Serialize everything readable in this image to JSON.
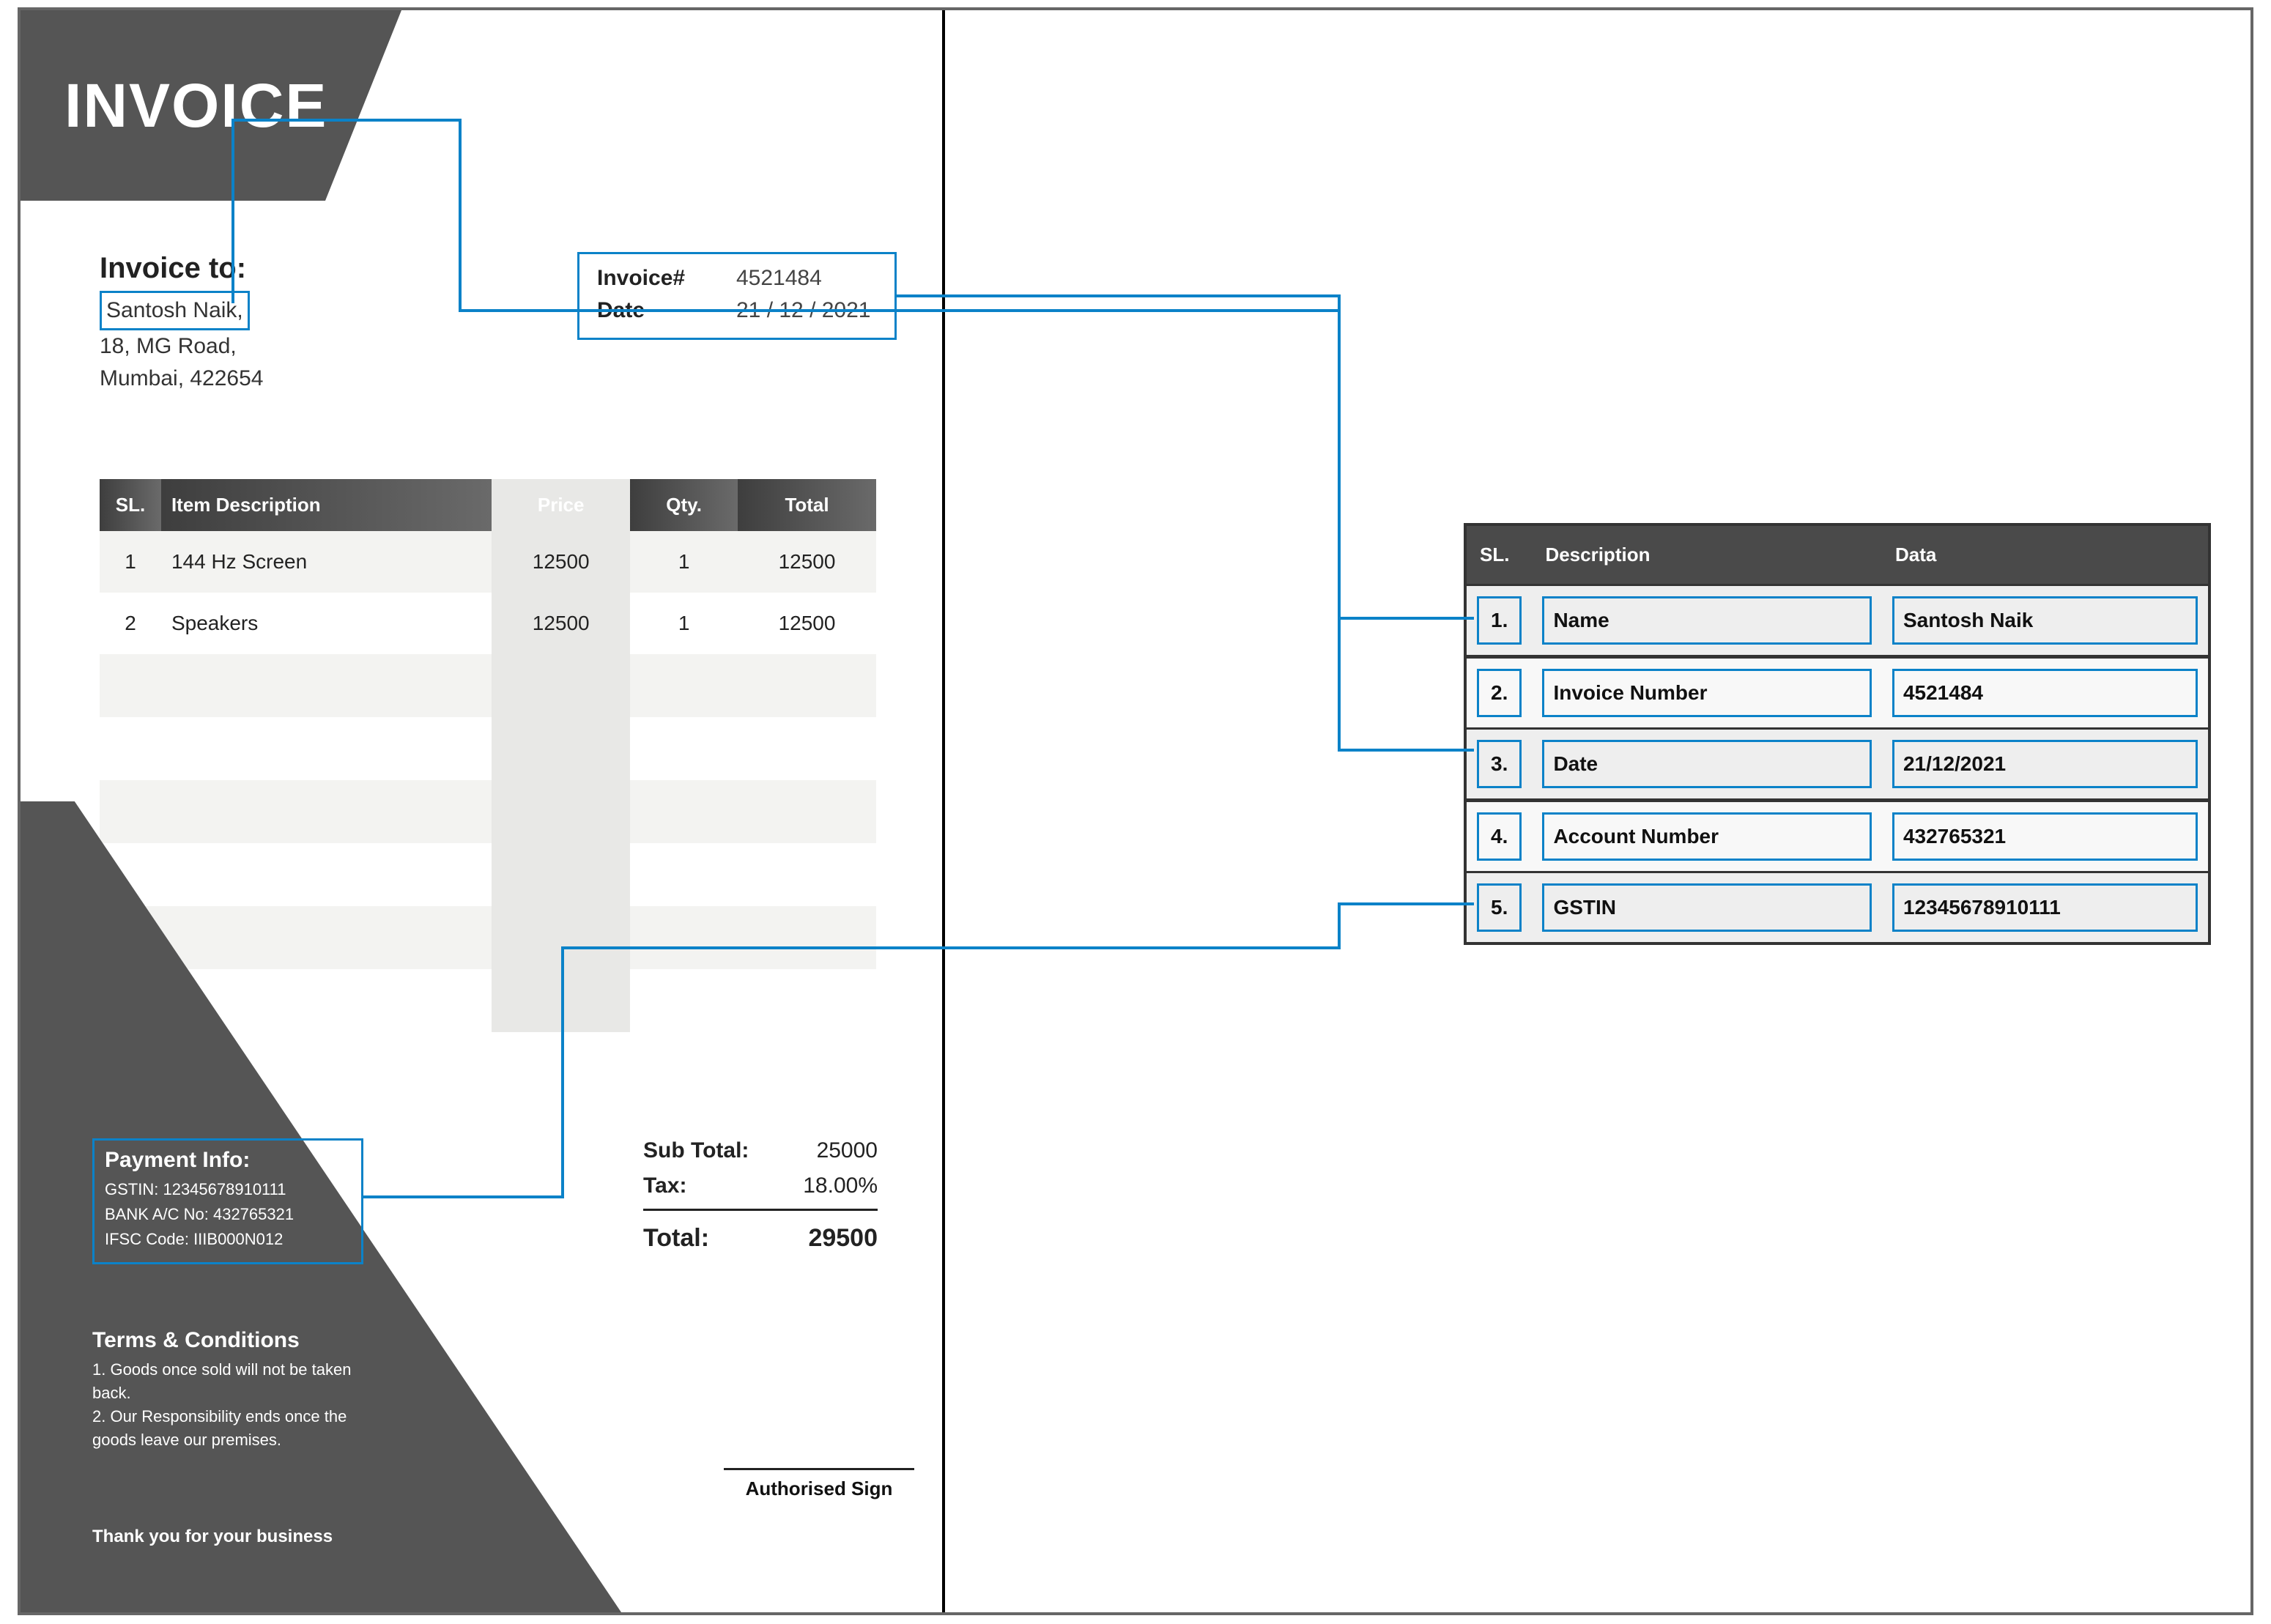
{
  "invoice": {
    "title": "INVOICE",
    "to_label": "Invoice to:",
    "to_name": "Santosh Naik,",
    "to_addr1": "18, MG Road,",
    "to_addr2": "Mumbai, 422654",
    "meta": {
      "number_label": "Invoice#",
      "number_value": "4521484",
      "date_label": "Date",
      "date_value": "21 / 12 / 2021"
    },
    "headers": {
      "sl": "SL.",
      "desc": "Item Description",
      "price": "Price",
      "qty": "Qty.",
      "total": "Total"
    },
    "items": [
      {
        "sl": "1",
        "desc": "144 Hz Screen",
        "price": "12500",
        "qty": "1",
        "total": "12500"
      },
      {
        "sl": "2",
        "desc": "Speakers",
        "price": "12500",
        "qty": "1",
        "total": "12500"
      }
    ],
    "payment": {
      "head": "Payment Info:",
      "gstin_label": "GSTIN:",
      "gstin_value": "12345678910111",
      "bank_label": "BANK A/C No:",
      "bank_value": "432765321",
      "ifsc_label": "IFSC Code:",
      "ifsc_value": "IIIB000N012"
    },
    "totals": {
      "sub_label": "Sub Total:",
      "sub_value": "25000",
      "tax_label": "Tax:",
      "tax_value": "18.00%",
      "tot_label": "Total:",
      "tot_value": "29500"
    },
    "terms": {
      "head": "Terms & Conditions",
      "l1": "1. Goods once sold will not be taken back.",
      "l2": "2. Our Responsibility ends once the goods leave our premises."
    },
    "thanks": "Thank you for your business",
    "sign_label": "Authorised Sign"
  },
  "extract": {
    "headers": {
      "sl": "SL.",
      "desc": "Description",
      "data": "Data"
    },
    "rows": [
      {
        "sl": "1.",
        "desc": "Name",
        "data": "Santosh Naik"
      },
      {
        "sl": "2.",
        "desc": "Invoice Number",
        "data": "4521484"
      },
      {
        "sl": "3.",
        "desc": "Date",
        "data": "21/12/2021"
      },
      {
        "sl": "4.",
        "desc": "Account Number",
        "data": "432765321"
      },
      {
        "sl": "5.",
        "desc": "GSTIN",
        "data": "12345678910111"
      }
    ]
  }
}
